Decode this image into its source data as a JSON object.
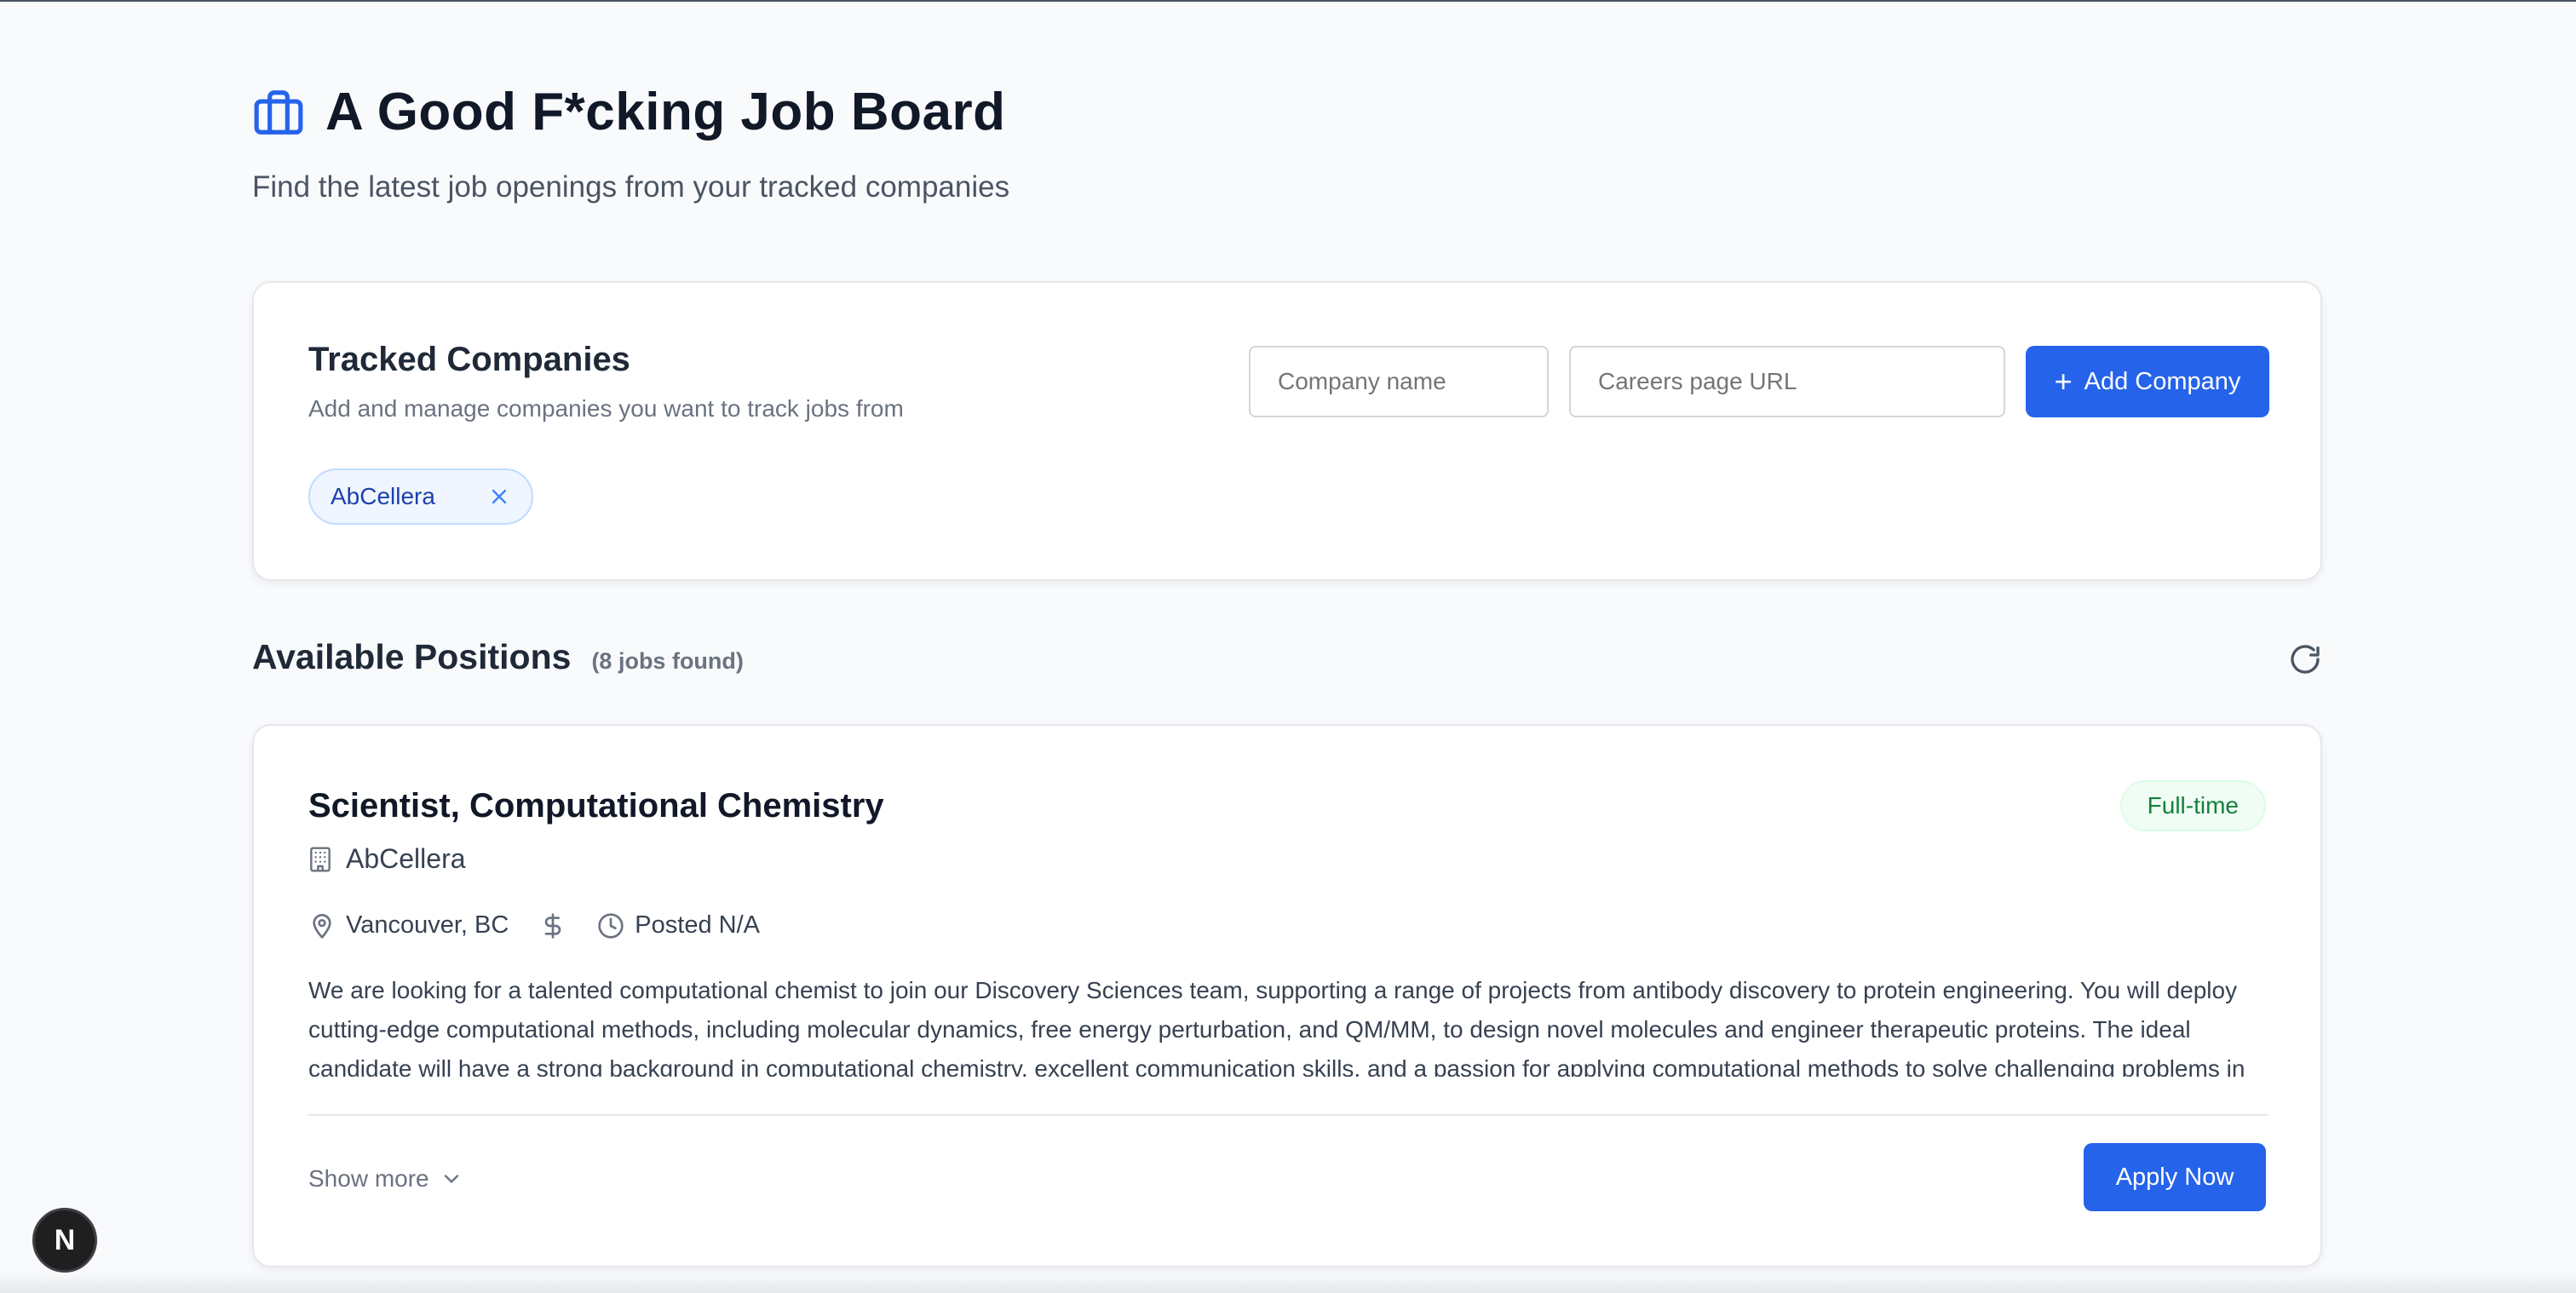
{
  "header": {
    "title": "A Good F*cking Job Board",
    "subtitle": "Find the latest job openings from your tracked companies",
    "icon": "briefcase-icon",
    "accent": "#2563eb"
  },
  "tracked": {
    "title": "Tracked Companies",
    "description": "Add and manage companies you want to track jobs from",
    "company_placeholder": "Company name",
    "url_placeholder": "Careers page URL",
    "add_label": "Add Company",
    "chips": [
      {
        "label": "AbCellera"
      }
    ]
  },
  "positions": {
    "title": "Available Positions",
    "count": "(8 jobs found)"
  },
  "jobs": [
    {
      "title": "Scientist, Computational Chemistry",
      "type": "Full-time",
      "company": "AbCellera",
      "location": "Vancouver, BC",
      "salary_icon": "dollar-icon",
      "posted": "Posted N/A",
      "description": "We are looking for a talented computational chemist to join our Discovery Sciences team, supporting a range of projects from antibody discovery to protein engineering. You will deploy cutting-edge computational methods, including molecular dynamics, free energy perturbation, and QM/MM, to design novel molecules and engineer therapeutic proteins. The ideal candidate will have a strong background in computational chemistry, excellent communication skills, and a passion for applying computational methods to solve challenging problems in",
      "show_more": "Show more",
      "apply": "Apply Now"
    }
  ],
  "dev_badge": "N"
}
